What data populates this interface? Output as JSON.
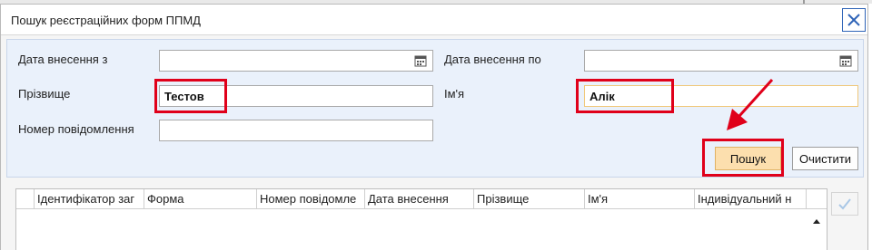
{
  "dialog": {
    "title": "Пошук реєстраційних форм ППМД"
  },
  "form": {
    "date_from_label": "Дата внесення з",
    "date_to_label": "Дата внесення по",
    "surname_label": "Прізвище",
    "surname_value": "Тестов",
    "name_label": "Ім'я",
    "name_value": "Алік",
    "message_number_label": "Номер повідомлення",
    "search_button": "Пошук",
    "clear_button": "Очистити"
  },
  "grid": {
    "columns": [
      "Ідентифікатор заг",
      "Форма",
      "Номер повідомле",
      "Дата внесення",
      "Прізвище",
      "Ім'я",
      "Індивідуальний н"
    ]
  },
  "colors": {
    "highlight": "#e0001a",
    "primary_button": "#fcdfae",
    "form_background": "#eaf1fb"
  }
}
